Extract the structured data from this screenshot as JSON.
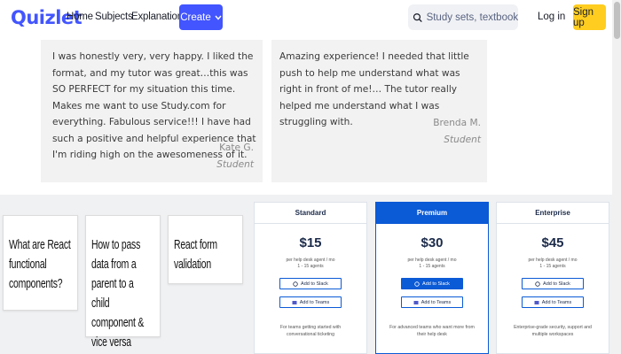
{
  "header": {
    "logo": "Quizlet",
    "nav": {
      "home": "Home",
      "subjects": "Subjects",
      "explanations": "Explanations"
    },
    "create_label": "Create",
    "search_placeholder": "Study sets, textbooks, ...",
    "login_label": "Log in",
    "signup_label": "Sign up"
  },
  "testimonials": [
    {
      "text": "I was honestly very, very happy. I liked the format, and my tutor was great…this was SO PERFECT for my situation this time. Makes me want to use Study.com for everything. Fabulous service!!! I have had such a positive and helpful experience that I'm riding high on the awesomeness of it.",
      "name": "Kate G.",
      "role": "Student"
    },
    {
      "text": "Amazing experience! I needed that little push to help me understand what was right in front of me!… The tutor really helped me understand what I was struggling with.",
      "name": "Brenda M.",
      "role": "Student"
    }
  ],
  "articles": [
    {
      "title": "What are React functional components?"
    },
    {
      "title": "How to pass data from a parent to a child component & vice versa"
    },
    {
      "title": "React form validation"
    }
  ],
  "pricing": {
    "plans": [
      {
        "name": "Standard",
        "price": "$15",
        "sub_line1": "per help desk agent / mo",
        "sub_line2": "1 - 15 agents",
        "btn_slack": "Add to Slack",
        "btn_teams": "Add to Teams",
        "desc": "For teams getting started with conversational ticketing"
      },
      {
        "name": "Premium",
        "price": "$30",
        "sub_line1": "per help desk agent / mo",
        "sub_line2": "1 - 15 agents",
        "btn_slack": "Add to Slack",
        "btn_teams": "Add to Teams",
        "desc": "For advanced teams who want more from their help desk"
      },
      {
        "name": "Enterprise",
        "price": "$45",
        "sub_line1": "per help desk agent / mo",
        "sub_line2": "1 - 15 agents",
        "btn_slack": "Add to Slack",
        "btn_teams": "Add to Teams",
        "desc": "Enterprise-grade security, support and multiple workspaces"
      }
    ]
  },
  "colors": {
    "brand": "#4255ff",
    "signup": "#ffcd1f",
    "premium": "#0b5ad6"
  }
}
